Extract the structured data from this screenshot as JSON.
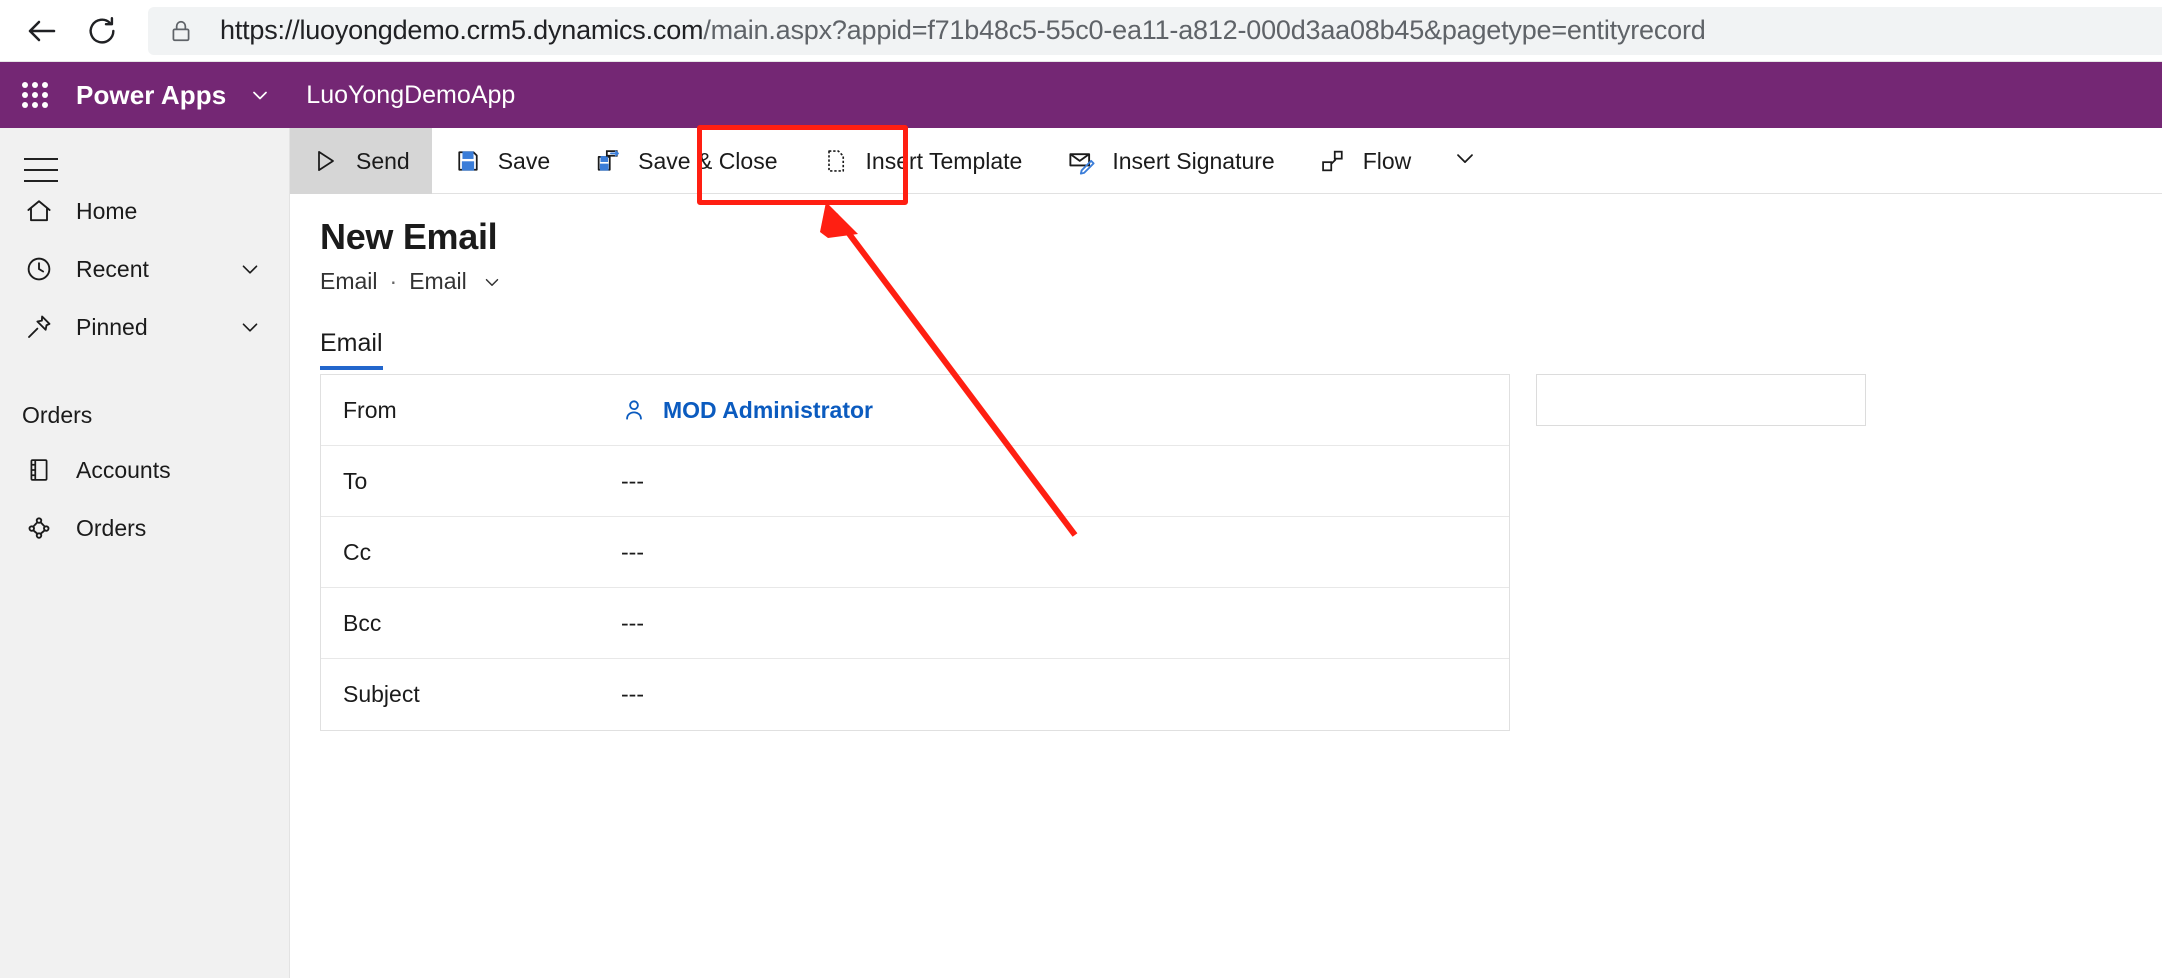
{
  "browser": {
    "back_icon": "arrow-left-icon",
    "forward_icon": "arrow-right-icon",
    "reload_icon": "reload-icon",
    "lock_icon": "lock-icon",
    "url_scheme": "https://",
    "url_host": "luoyongdemo.crm5.dynamics.com",
    "url_path": "/main.aspx?appid=f71b48c5-55c0-ea11-a812-000d3aa08b45&pagetype=entityrecord"
  },
  "app_header": {
    "waffle_icon": "app-launcher-icon",
    "brand": "Power Apps",
    "brand_chevron_icon": "chevron-down-icon",
    "app_name": "LuoYongDemoApp",
    "background_color": "#742774"
  },
  "sidebar": {
    "hamburger_icon": "hamburger-menu-icon",
    "items": [
      {
        "label": "Home",
        "icon": "home-icon",
        "chevron": false
      },
      {
        "label": "Recent",
        "icon": "clock-icon",
        "chevron": true
      },
      {
        "label": "Pinned",
        "icon": "pin-icon",
        "chevron": true
      }
    ],
    "group_title": "Orders",
    "group_items": [
      {
        "label": "Accounts",
        "icon": "accounts-book-icon"
      },
      {
        "label": "Orders",
        "icon": "orders-icon"
      }
    ]
  },
  "command_bar": {
    "items": [
      {
        "label": "Send",
        "icon": "send-icon",
        "active": true
      },
      {
        "label": "Save",
        "icon": "save-floppy-icon",
        "active": false
      },
      {
        "label": "Save & Close",
        "icon": "save-and-close-icon",
        "active": false
      },
      {
        "label": "Insert Template",
        "icon": "insert-template-icon",
        "active": false
      },
      {
        "label": "Insert Signature",
        "icon": "insert-signature-icon",
        "active": false
      },
      {
        "label": "Flow",
        "icon": "flow-icon",
        "active": false
      }
    ],
    "overflow_chevron_icon": "chevron-down-icon"
  },
  "form": {
    "title": "New Email",
    "entity": "Email",
    "separator": "·",
    "form_name": "Email",
    "form_chevron_icon": "chevron-down-icon",
    "tabs": [
      {
        "label": "Email",
        "selected": true
      }
    ],
    "fields": [
      {
        "label": "From",
        "value": "MOD Administrator",
        "is_link": true,
        "icon": "person-icon"
      },
      {
        "label": "To",
        "value": "---",
        "is_link": false
      },
      {
        "label": "Cc",
        "value": "---",
        "is_link": false
      },
      {
        "label": "Bcc",
        "value": "---",
        "is_link": false
      },
      {
        "label": "Subject",
        "value": "---",
        "is_link": false
      }
    ]
  },
  "annotation": {
    "highlight_color": "#ff1f12",
    "target": "Insert Template",
    "shapes": [
      "rectangle",
      "arrow"
    ]
  }
}
